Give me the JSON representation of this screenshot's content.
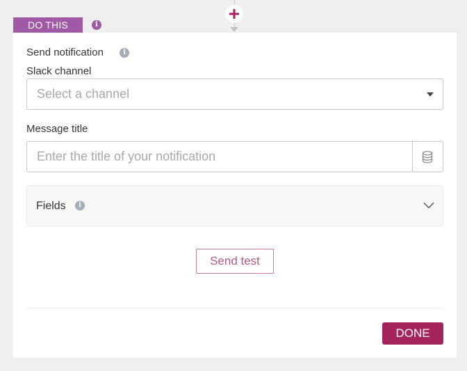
{
  "step": {
    "tag_label": "DO THIS",
    "add_icon": "plus-icon"
  },
  "form": {
    "section_title": "Send notification",
    "slack_channel": {
      "label": "Slack channel",
      "placeholder": "Select a channel",
      "value": ""
    },
    "message_title": {
      "label": "Message title",
      "placeholder": "Enter the title of your notification",
      "value": ""
    },
    "fields": {
      "label": "Fields",
      "expanded": false
    },
    "send_test_label": "Send test",
    "done_label": "DONE"
  },
  "colors": {
    "tag_bg": "#a05aa5",
    "accent": "#a6245e",
    "send_test_text": "#b25a85",
    "info_icon_gray": "#a5adb8"
  }
}
